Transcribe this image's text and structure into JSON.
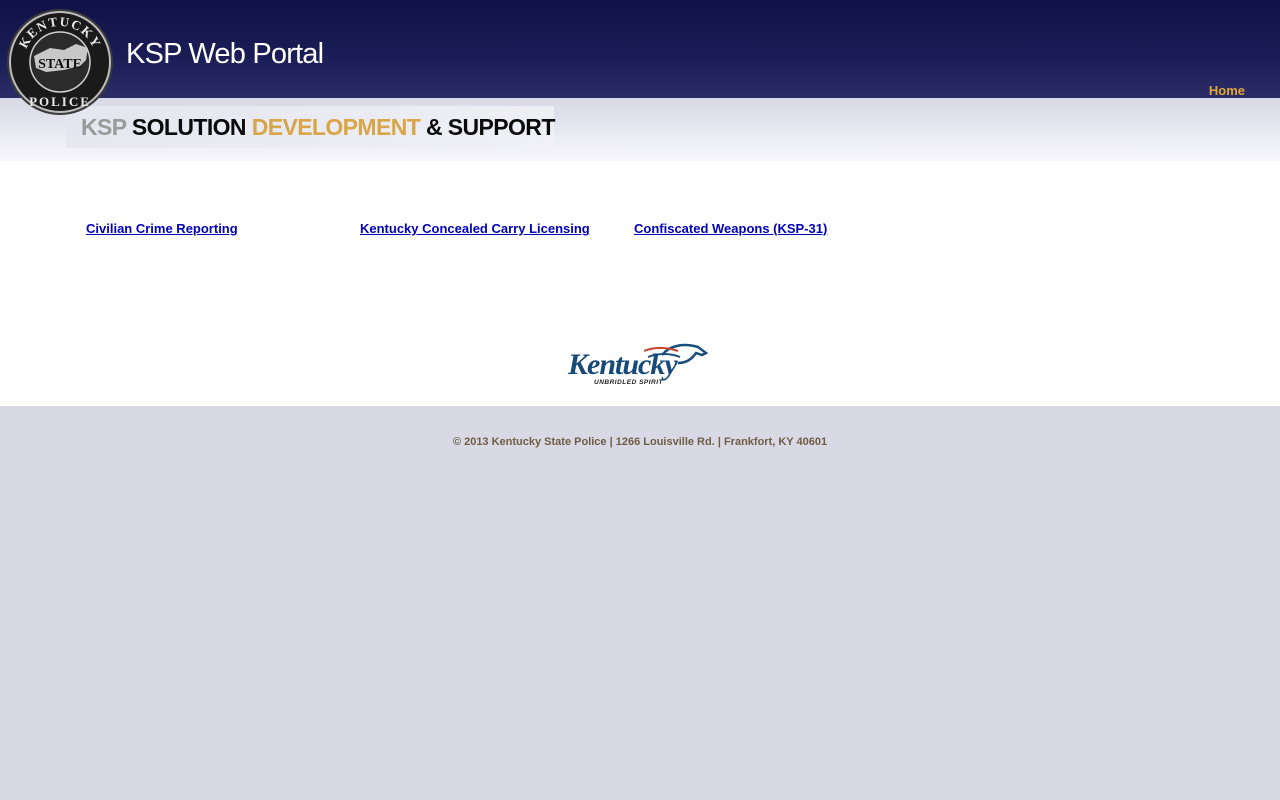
{
  "header": {
    "seal_text_top": "KENTUCKY",
    "seal_text_middle": "STATE",
    "seal_text_bottom": "POLICE",
    "title": "KSP Web Portal",
    "nav": {
      "home_label": "Home"
    }
  },
  "banner": {
    "ksp": "KSP",
    "solution": "SOLUTION",
    "development": "DEVELOPMENT",
    "support": "& SUPPORT"
  },
  "links": [
    {
      "label": "Civilian Crime Reporting"
    },
    {
      "label": "Kentucky Concealed Carry Licensing"
    },
    {
      "label": "Confiscated Weapons (KSP-31)"
    }
  ],
  "logo": {
    "wordmark": "Kentucky",
    "tagline": "UNBRIDLED SPIRIT"
  },
  "footer": {
    "text": "© 2013 Kentucky State Police | 1266 Louisville Rd. | Frankfort, KY 40601"
  },
  "colors": {
    "header_dark": "#0f1147",
    "nav_accent": "#e2a53a",
    "banner_gold": "#d8a548",
    "link_blue": "#0000b8",
    "footer_text": "#6f5d44",
    "page_background": "#d9d9e6"
  }
}
